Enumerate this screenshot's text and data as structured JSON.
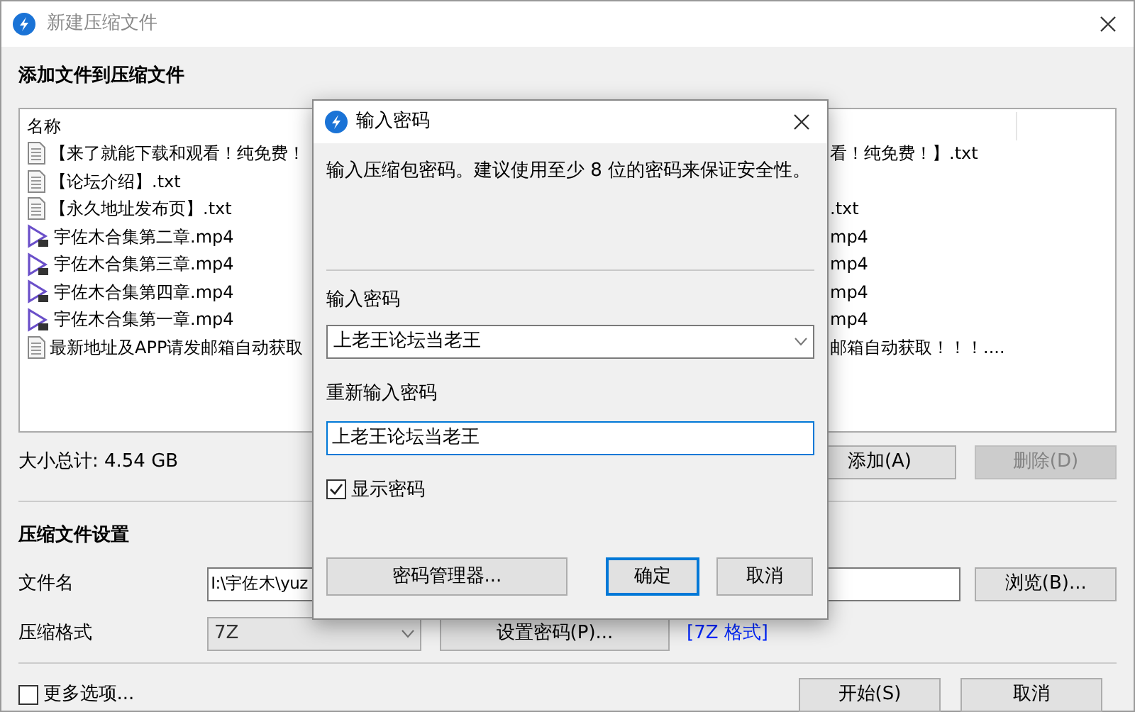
{
  "window": {
    "title": "新建压缩文件"
  },
  "add_section": {
    "heading": "添加文件到压缩文件"
  },
  "file_list": {
    "columns": [
      "名称"
    ],
    "rows": [
      {
        "kind": "text",
        "name": "【来了就能下载和观看！纯免费！",
        "column_2": "看！纯免费！】.txt"
      },
      {
        "kind": "text",
        "name": "【论坛介绍】.txt"
      },
      {
        "kind": "text",
        "name": "【永久地址发布页】.txt",
        "column_2": ".txt"
      },
      {
        "kind": "video",
        "name": "宇佐木合集第二章.mp4",
        "column_2": "mp4"
      },
      {
        "kind": "video",
        "name": "宇佐木合集第三章.mp4",
        "column_2": "mp4"
      },
      {
        "kind": "video",
        "name": "宇佐木合集第四章.mp4",
        "column_2": "mp4"
      },
      {
        "kind": "video",
        "name": "宇佐木合集第一章.mp4",
        "column_2": "mp4"
      },
      {
        "kind": "text",
        "name": "最新地址及APP请发邮箱自动获取",
        "column_2": "邮箱自动获取！！！...."
      }
    ]
  },
  "total_size": "大小总计: 4.54 GB",
  "list_buttons": [
    {
      "label": "添加(A)",
      "disabled": false
    },
    {
      "label": "删除(D)",
      "disabled": true
    }
  ],
  "settings": {
    "heading": "压缩文件设置",
    "filename_label": "文件名",
    "filename_value": "I:\\宇佐木\\yuz",
    "browse_button": "浏览(B)...",
    "format_label": "压缩格式",
    "format_value": "7Z",
    "password_button": "设置密码(P)...",
    "format_link": "[7Z 格式]"
  },
  "more_options": {
    "label": "更多选项...",
    "checked": false
  },
  "footer_buttons": [
    "开始(S)",
    "取消"
  ],
  "dialog": {
    "title": "输入密码",
    "message": "输入压缩包密码。建议使用至少 8 位的密码来保证安全性。",
    "password_label": "输入密码",
    "password_value": "上老王论坛当老王",
    "confirm_label": "重新输入密码",
    "confirm_value": "上老王论坛当老王",
    "show_password": {
      "label": "显示密码",
      "checked": true
    },
    "buttons": [
      {
        "label": "密码管理器...",
        "default": false
      },
      {
        "label": "确定",
        "default": true
      },
      {
        "label": "取消",
        "default": false
      }
    ]
  }
}
